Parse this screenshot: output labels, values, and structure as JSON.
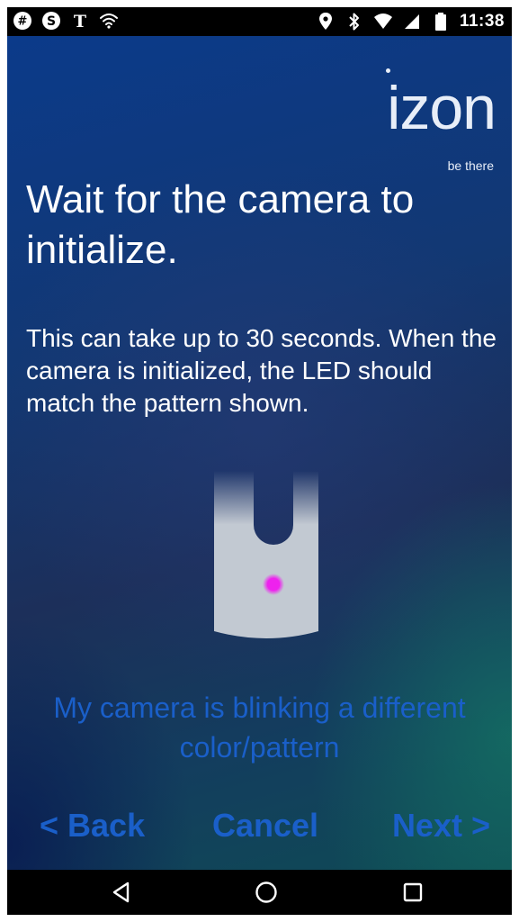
{
  "status_bar": {
    "time": "11:38",
    "left_icons": [
      "hangouts-icon",
      "skype-icon",
      "nytimes-icon",
      "wifi-icon"
    ],
    "right_icons": [
      "location-pin-icon",
      "bluetooth-icon",
      "wifi-signal-icon",
      "cell-signal-icon",
      "battery-icon"
    ]
  },
  "logo": {
    "word": "izon",
    "tagline": "be there"
  },
  "headline": "Wait for the camera to initialize.",
  "body": "This can take up to 30 seconds. When the camera is initialized, the LED should match the pattern shown.",
  "camera": {
    "led_color": "#ee22ee",
    "body_color": "#c2c9d2"
  },
  "alt_link": "My camera is blinking a different color/pattern",
  "actions": {
    "back": "< Back",
    "cancel": "Cancel",
    "next": "Next >"
  },
  "colors": {
    "link_blue": "#1a5fc9",
    "background_top": "#0b3a8a",
    "background_bottom_right": "#0f4a55"
  },
  "system_nav": [
    "back-triangle-icon",
    "home-circle-icon",
    "recents-square-icon"
  ]
}
